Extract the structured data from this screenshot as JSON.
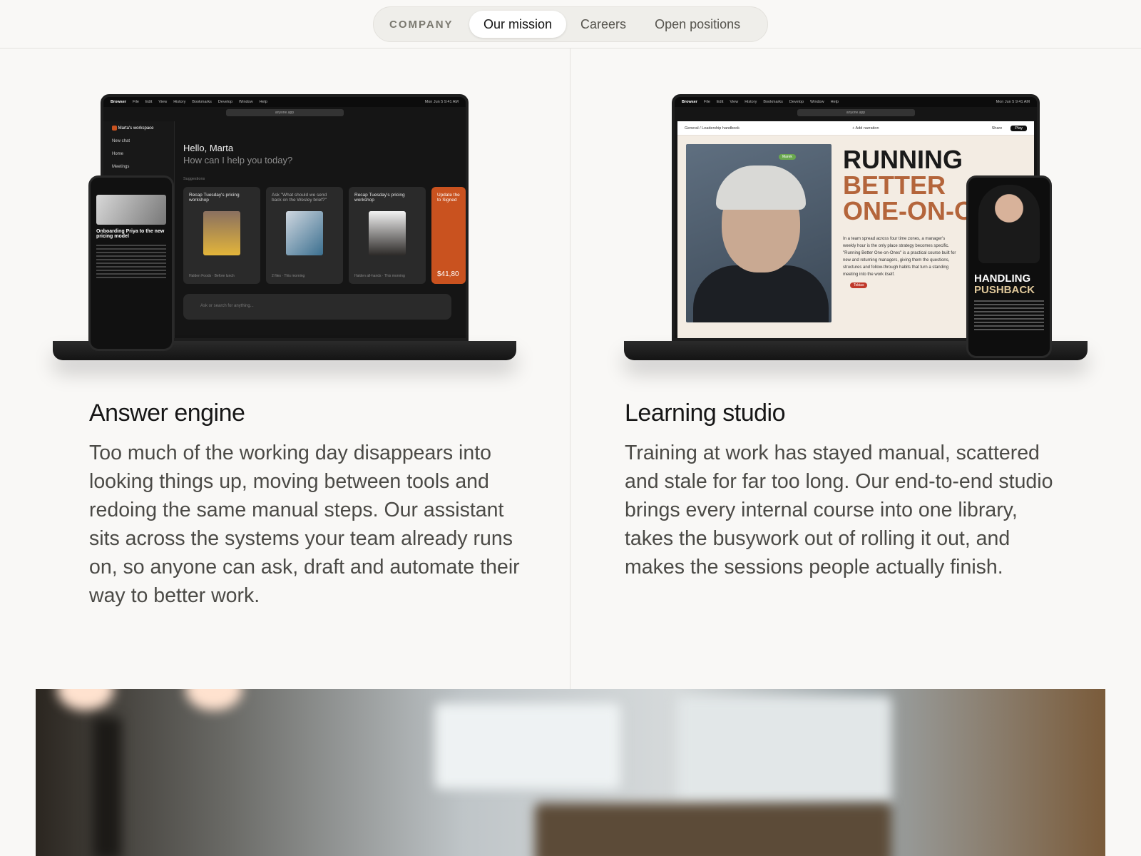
{
  "nav": {
    "brand": "COMPANY",
    "tabs": [
      {
        "label": "Our mission",
        "active": true
      },
      {
        "label": "Careers",
        "active": false
      },
      {
        "label": "Open positions",
        "active": false
      }
    ]
  },
  "features": [
    {
      "title": "Answer engine",
      "body": "Too much of the working day disappears into looking things up, moving between tools and redoing the same manual steps. Our assistant sits across the systems your team already runs on, so anyone can ask, draft and automate their way to better work.",
      "mock": {
        "menubar": [
          "Browser",
          "File",
          "Edit",
          "View",
          "History",
          "Bookmarks",
          "Develop",
          "Window",
          "Help"
        ],
        "clock": "Mon Jun 5  9:41 AM",
        "url": "anyone.app",
        "workspace": "Marta's workspace",
        "sidebar": [
          "New chat",
          "Home",
          "Meetings"
        ],
        "greeting": "Hello, Marta",
        "prompt": "How can I help you today?",
        "suggestions_label": "Suggestions",
        "cards": [
          {
            "title": "Recap Tuesday's pricing workshop",
            "foot": "Halden Foods · Before lunch"
          },
          {
            "title": "Ask \"What should we send back on the Wesley brief?\"",
            "foot": "2 files · This morning"
          },
          {
            "title": "Recap Tuesday's pricing workshop",
            "foot": "Halden all-hands · This morning"
          },
          {
            "title": "Update the to Signed",
            "foot": "$41,80"
          }
        ],
        "ask_placeholder": "Ask or search for anything...",
        "phone_title": "Onboarding Priya to the new pricing model"
      }
    },
    {
      "title": "Learning studio",
      "body": "Training at work has stayed manual, scattered and stale for far too long. Our end-to-end studio brings every internal course into one library, takes the busywork out of rolling it out, and makes the sessions people actually finish.",
      "mock": {
        "breadcrumb": "General / Leadership handbook",
        "add_narration": "+ Add narration",
        "share": "Share",
        "play": "Play",
        "headline_1": "RUNNING",
        "headline_2": "BETTER",
        "headline_3": "ONE-ON-O",
        "text": "In a team spread across four time zones, a manager's weekly hour is the only place strategy becomes specific. \"Running Better One-on-Ones\" is a practical course built for new and returning managers, giving them the questions, structures and follow-through habits that turn a standing meeting into the work itself.",
        "tag_1": "Marek",
        "tag_2": "Tobias",
        "phone_headline_1": "HANDLING",
        "phone_headline_2": "PUSHBACK"
      }
    }
  ],
  "colors": {
    "accent": "#b4653b",
    "orange": "#c9521f",
    "background": "#f9f8f6"
  }
}
